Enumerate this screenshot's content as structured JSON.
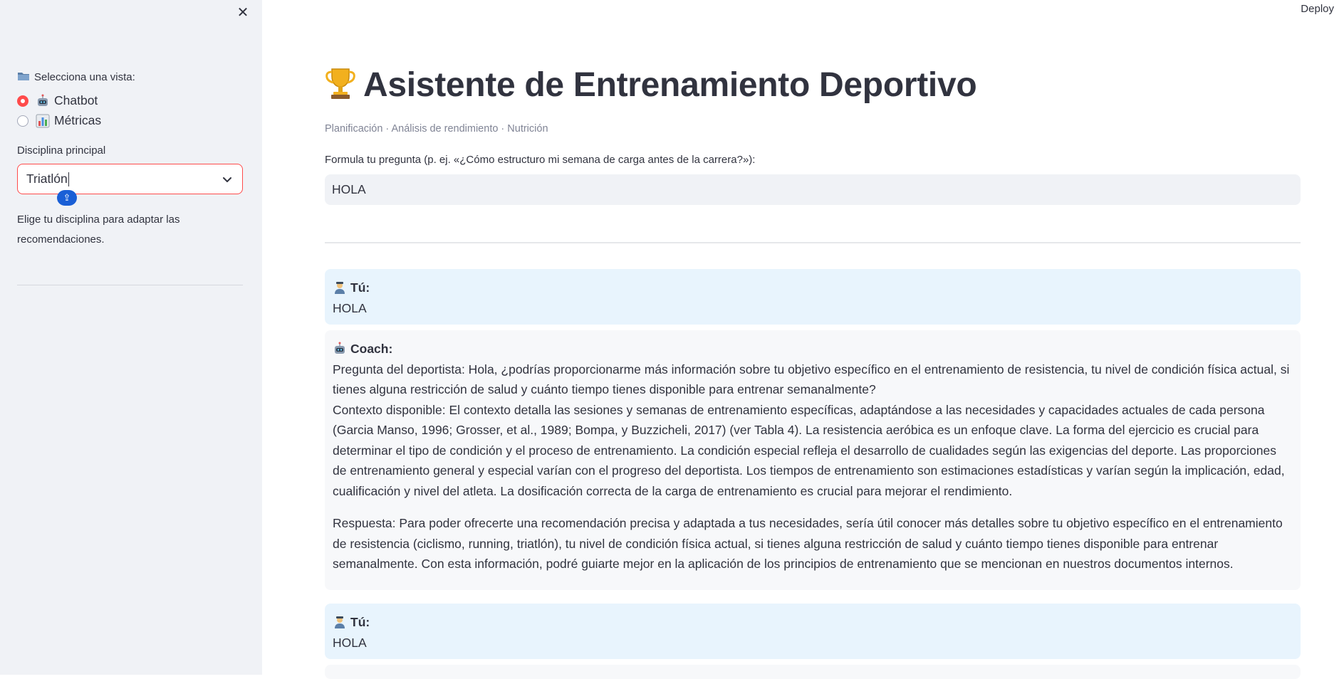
{
  "sidebar": {
    "close_icon": "close-icon",
    "view_label": "Selecciona una vista:",
    "view_options": [
      {
        "label": "Chatbot",
        "selected": true
      },
      {
        "label": "Métricas",
        "selected": false
      }
    ],
    "discipline_label": "Disciplina principal",
    "discipline_value": "Triatlón",
    "discipline_help": "Elige tu disciplina para adaptar las recomendaciones."
  },
  "header": {
    "deploy_label": "Deploy"
  },
  "main": {
    "title": "Asistente de Entrenamiento Deportivo",
    "subtitle": "Planificación · Análisis de rendimiento · Nutrición",
    "question_label": "Formula tu pregunta (p. ej. «¿Cómo estructuro mi semana de carga antes de la carrera?»):",
    "question_value": "HOLA",
    "messages": [
      {
        "role": "user",
        "author": "Tú:",
        "text": "HOLA"
      },
      {
        "role": "bot",
        "author": "Coach:",
        "question_line": "Pregunta del deportista: Hola, ¿podrías proporcionarme más información sobre tu objetivo específico en el entrenamiento de resistencia, tu nivel de condición física actual, si tienes alguna restricción de salud y cuánto tiempo tienes disponible para entrenar semanalmente?",
        "context_line": "Contexto disponible: El contexto detalla las sesiones y semanas de entrenamiento específicas, adaptándose a las necesidades y capacidades actuales de cada persona (Garcia Manso, 1996; Grosser, et al., 1989; Bompa, y Buzzicheli, 2017) (ver Tabla 4). La resistencia aeróbica es un enfoque clave. La forma del ejercicio es crucial para determinar el tipo de condición y el proceso de entrenamiento. La condición especial refleja el desarrollo de cualidades según las exigencias del deporte. Las proporciones de entrenamiento general y especial varían con el progreso del deportista. Los tiempos de entrenamiento son estimaciones estadísticas y varían según la implicación, edad, cualificación y nivel del atleta. La dosificación correcta de la carga de entrenamiento es crucial para mejorar el rendimiento.",
        "answer_line": "Respuesta: Para poder ofrecerte una recomendación precisa y adaptada a tus necesidades, sería útil conocer más detalles sobre tu objetivo específico en el entrenamiento de resistencia (ciclismo, running, triatlón), tu nivel de condición física actual, si tienes alguna restricción de salud y cuánto tiempo tienes disponible para entrenar semanalmente. Con esta información, podré guiarte mejor en la aplicación de los principios de entrenamiento que se mencionan en nuestros documentos internos."
      },
      {
        "role": "user",
        "author": "Tú:",
        "text": "HOLA"
      }
    ]
  },
  "colors": {
    "accent": "#ff4b4b",
    "sidebar_bg": "#f0f2f6",
    "user_bubble": "#e8f4fd",
    "bot_bubble": "#f7f8fa"
  }
}
